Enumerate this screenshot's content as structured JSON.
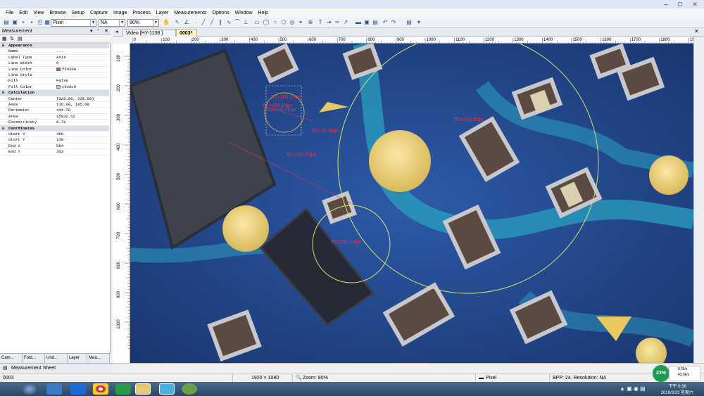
{
  "menu": [
    "File",
    "Edit",
    "View",
    "Browse",
    "Setup",
    "Capture",
    "Image",
    "Process",
    "Layer",
    "Measurements",
    "Options",
    "Window",
    "Help"
  ],
  "toolbar": {
    "unit_value": "Pixel",
    "na_value": "NA",
    "zoom_value": "80%"
  },
  "panel": {
    "title": "Measurement",
    "properties": [
      {
        "cat": true,
        "key": "Appearance"
      },
      {
        "key": "Name",
        "value": "..."
      },
      {
        "key": "Label Type",
        "value": "Axis"
      },
      {
        "key": "Line Width",
        "value": "0"
      },
      {
        "key": "Line Color",
        "value": "ff4200",
        "swatch": "#ff4200"
      },
      {
        "key": "Line Style",
        "value": ""
      },
      {
        "key": "Fill",
        "value": "False"
      },
      {
        "key": "Fill Color",
        "value": "c0c0c0",
        "swatch": "#c0c0c0"
      },
      {
        "cat": true,
        "key": "Calculation"
      },
      {
        "key": "Center",
        "value": "(526.00, 220.50)"
      },
      {
        "key": "Axes",
        "value": "116.00, 185.00"
      },
      {
        "key": "Perimeter",
        "value": "444.76"
      },
      {
        "key": "Area",
        "value": "15032.52"
      },
      {
        "key": "Eccentricity",
        "value": "0.71"
      },
      {
        "cat": true,
        "key": "Coordinates"
      },
      {
        "key": "Start X",
        "value": "468"
      },
      {
        "key": "Start Y",
        "value": "138"
      },
      {
        "key": "End X",
        "value": "584"
      },
      {
        "key": "End Y",
        "value": "303"
      }
    ],
    "tabs": [
      "Cam...",
      "Fold...",
      "Und...",
      "Layer",
      "Mea..."
    ]
  },
  "doc_tabs": [
    "Video [HY-1138 ]",
    "0003*"
  ],
  "ruler_top": [
    "0",
    "100",
    "200",
    "300",
    "400",
    "500",
    "600",
    "700",
    "800",
    "900",
    "1000",
    "1100",
    "1200",
    "1300",
    "1400",
    "1500",
    "1600",
    "1700",
    "1800",
    "1900"
  ],
  "ruler_left": [
    "100",
    "200",
    "300",
    "400",
    "500",
    "600",
    "700",
    "800",
    "900",
    "1000"
  ],
  "overlays": [
    "R1=106.15px",
    "R1=106.15px",
    "R1=106.15px",
    "R1=31.45px",
    "R1=231.52px",
    "R1=251.15px",
    "R1=103.00px"
  ],
  "bottom_tab": "Measurement Sheet",
  "status": {
    "frame": "0003",
    "resolution": "1920 × 1080",
    "zoom": "Zoom: 80%",
    "unit": "Pixel",
    "bpp": "BPP: 24, Resolution: NA"
  },
  "tray": {
    "cpu": "23%",
    "up": "0.6k/s",
    "down": "43.9k/s",
    "time": "下午 6:36",
    "date": "2019/3/23 星期六"
  }
}
